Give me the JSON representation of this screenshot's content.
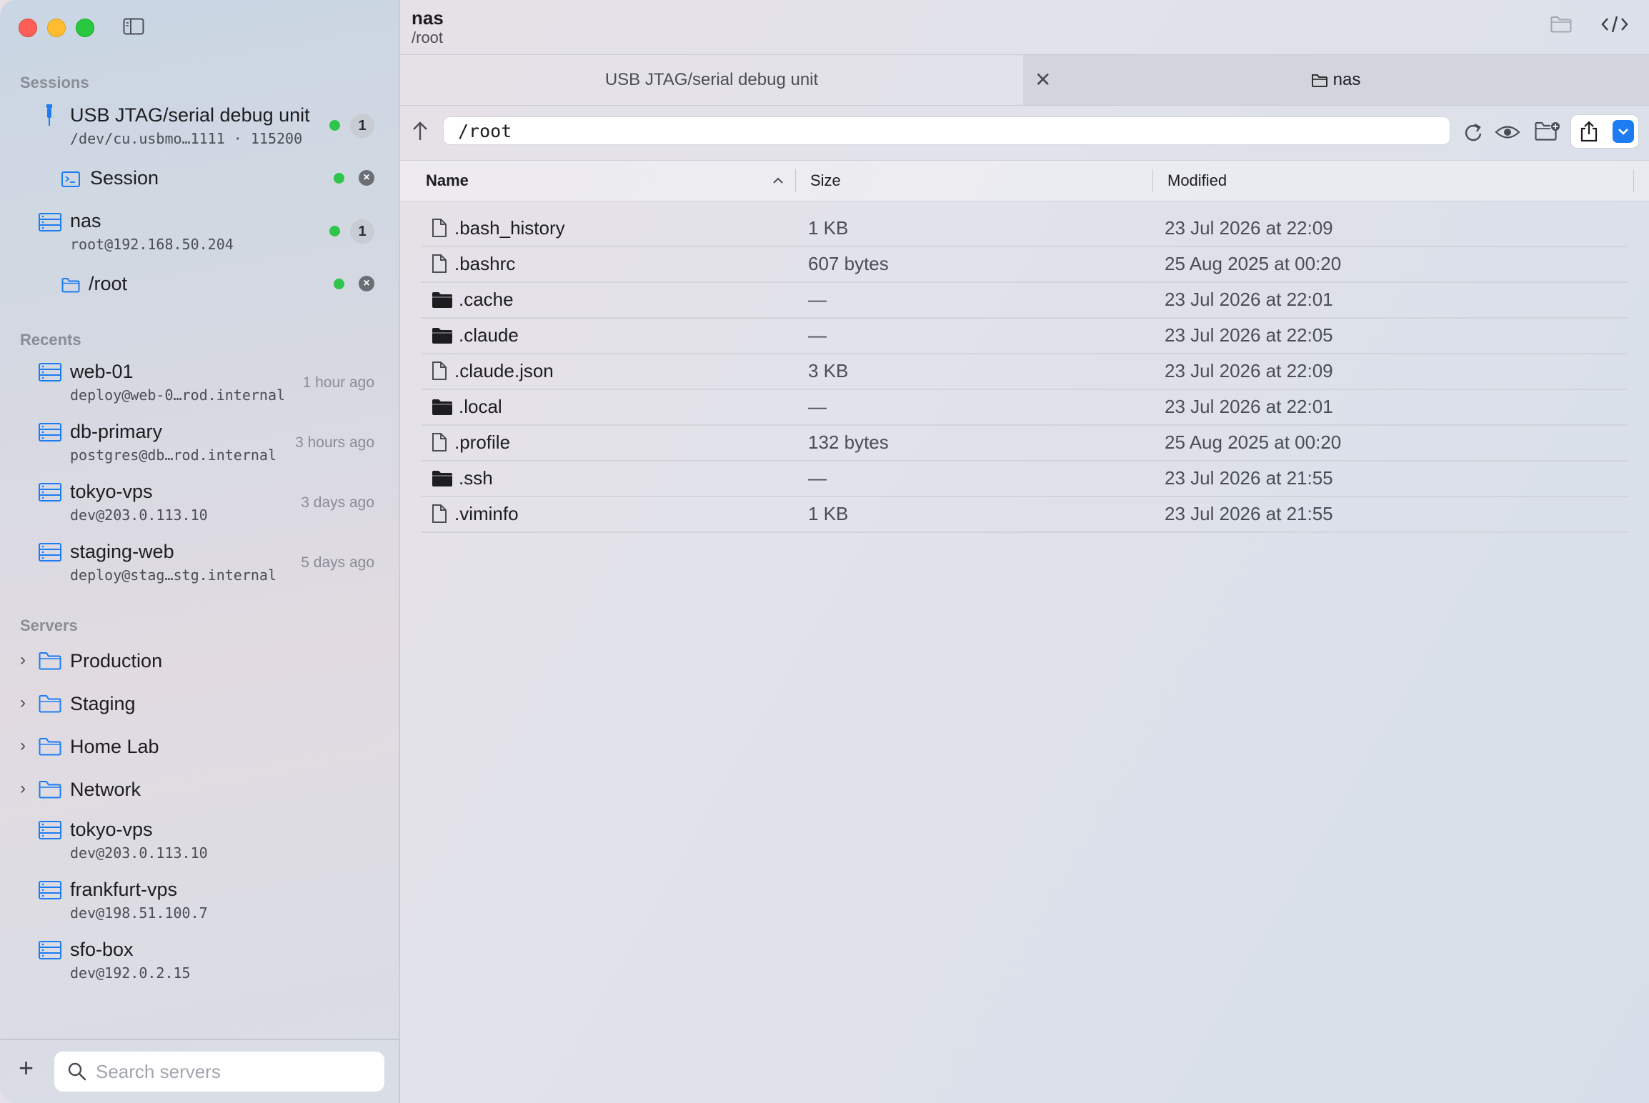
{
  "window": {
    "title": "nas",
    "subtitle": "/root"
  },
  "sidebar": {
    "sessions_label": "Sessions",
    "sessions": [
      {
        "title": "USB JTAG/serial debug unit",
        "subtitle": "/dev/cu.usbmo…1111 · 115200",
        "badge": "1",
        "icon": "usb-plug-icon"
      },
      {
        "title": "Session",
        "icon": "terminal-icon"
      },
      {
        "title": "nas",
        "subtitle": "root@192.168.50.204",
        "badge": "1",
        "icon": "server-icon"
      },
      {
        "title": "/root",
        "icon": "folder-icon"
      }
    ],
    "recents_label": "Recents",
    "recents": [
      {
        "title": "web-01",
        "subtitle": "deploy@web-0…rod.internal",
        "time": "1 hour ago"
      },
      {
        "title": "db-primary",
        "subtitle": "postgres@db…rod.internal",
        "time": "3 hours ago"
      },
      {
        "title": "tokyo-vps",
        "subtitle": "dev@203.0.113.10",
        "time": "3 days ago"
      },
      {
        "title": "staging-web",
        "subtitle": "deploy@stag…stg.internal",
        "time": "5 days ago"
      }
    ],
    "servers_label": "Servers",
    "groups": [
      {
        "label": "Production"
      },
      {
        "label": "Staging"
      },
      {
        "label": "Home Lab"
      },
      {
        "label": "Network"
      }
    ],
    "servers": [
      {
        "title": "tokyo-vps",
        "subtitle": "dev@203.0.113.10"
      },
      {
        "title": "frankfurt-vps",
        "subtitle": "dev@198.51.100.7"
      },
      {
        "title": "sfo-box",
        "subtitle": "dev@192.0.2.15"
      }
    ],
    "search": {
      "placeholder": "Search servers"
    },
    "add_label": "+"
  },
  "tabs": [
    {
      "label": "USB JTAG/serial debug unit"
    },
    {
      "label": "nas",
      "close": "✕"
    }
  ],
  "pathbar": {
    "path": "/root"
  },
  "table": {
    "headers": {
      "name": "Name",
      "size": "Size",
      "modified": "Modified"
    },
    "rows": [
      {
        "name": ".bash_history",
        "size": "1 KB",
        "modified": "23 Jul 2026 at 22:09",
        "type": "file"
      },
      {
        "name": ".bashrc",
        "size": "607 bytes",
        "modified": "25 Aug 2025 at 00:20",
        "type": "file"
      },
      {
        "name": ".cache",
        "size": "—",
        "modified": "23 Jul 2026 at 22:01",
        "type": "folder"
      },
      {
        "name": ".claude",
        "size": "—",
        "modified": "23 Jul 2026 at 22:05",
        "type": "folder"
      },
      {
        "name": ".claude.json",
        "size": "3 KB",
        "modified": "23 Jul 2026 at 22:09",
        "type": "file"
      },
      {
        "name": ".local",
        "size": "—",
        "modified": "23 Jul 2026 at 22:01",
        "type": "folder"
      },
      {
        "name": ".profile",
        "size": "132 bytes",
        "modified": "25 Aug 2025 at 00:20",
        "type": "file"
      },
      {
        "name": ".ssh",
        "size": "—",
        "modified": "23 Jul 2026 at 21:55",
        "type": "folder"
      },
      {
        "name": ".viminfo",
        "size": "1 KB",
        "modified": "23 Jul 2026 at 21:55",
        "type": "file"
      }
    ]
  },
  "colors": {
    "accent": "#1d7cf2",
    "status_online": "#2fc54a",
    "traffic_red": "#ff5f57",
    "traffic_yellow": "#febc2e",
    "traffic_green": "#28c840"
  }
}
